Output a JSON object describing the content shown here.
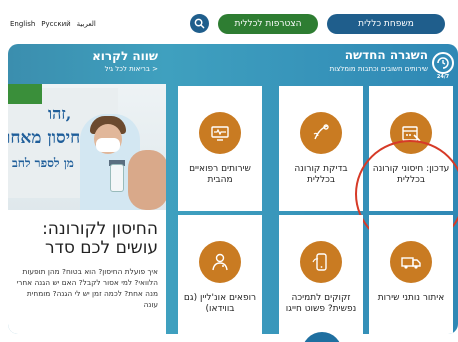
{
  "header": {
    "languages": [
      "English",
      "Русский",
      "العربية"
    ],
    "join_label": "הצטרפות לכללית",
    "family_label": "משפחת כללית"
  },
  "left": {
    "title": "שווה לקרוא",
    "subtitle": "בריאות לכל גיל >",
    "photo_sign_lines": [
      "זהו,",
      "חיסון מאחו",
      "מן לספר לחב"
    ],
    "article_title": "החיסון לקורונה: עושים לכם סדר",
    "article_body": "איך פועלת החיסון? הוא בטוח? מהן תופעות הלוואי? למי אסור לקבל? האם יש הגנה אחרי מנה אחת? לכמה זמן יש לי הגנה? מומחית עונה"
  },
  "section": {
    "title": "השגרה החדשה",
    "subtitle": "שירותים חשובים וכתבות מומלצות",
    "icon_label": "24/7"
  },
  "cards": [
    {
      "label": "עדכון: חיסוני קורונה בכללית",
      "icon": "vaccine-calendar-icon"
    },
    {
      "label": "בדיקת קורונה בכללית",
      "icon": "test-swab-icon"
    },
    {
      "label": "שירותים רפואיים מהבית",
      "icon": "home-monitor-icon"
    },
    {
      "label": "איתור נותני שירות",
      "icon": "truck-icon"
    },
    {
      "label": "זקוקים לתמיכה נפשית? פשוט חייגו",
      "icon": "phone-icon"
    },
    {
      "label": "רופאים אונ'ליין (גם בווידאו)",
      "icon": "doctor-icon"
    }
  ],
  "colors": {
    "brand_blue": "#1f5e8c",
    "join_green": "#2e7d32",
    "icon_orange": "#c97b22",
    "highlight_red": "#d63a27"
  }
}
